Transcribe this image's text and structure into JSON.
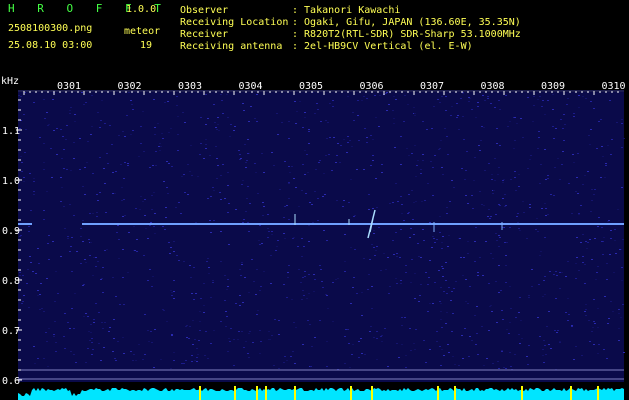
{
  "header": {
    "app_name": "H R O F F T",
    "version": "1.0.0",
    "filename": "2508100300.png",
    "datetime": "25.08.10 03:00",
    "meteor_label": "meteor",
    "meteor_count": "19"
  },
  "info": {
    "observer_label": "Observer",
    "observer_value": ": Takanori Kawachi",
    "location_label": "Receiving Location",
    "location_value": ": Ogaki, Gifu, JAPAN (136.60E, 35.35N)",
    "receiver_label": "Receiver",
    "receiver_value": ": R820T2(RTL-SDR) SDR-Sharp 53.1000MHz",
    "antenna_label": "Receiving antenna",
    "antenna_value": ": 2el-HB9CV Vertical (el. E-W)"
  },
  "axis": {
    "unit": "kHz",
    "y_ticks": [
      "1.1",
      "1.0",
      "0.9",
      "0.8",
      "0.7",
      "0.6"
    ],
    "x_ticks": [
      "0301",
      "0302",
      "0303",
      "0304",
      "0305",
      "0306",
      "0307",
      "0308",
      "0309",
      "0310"
    ]
  },
  "colors": {
    "background": "#000000",
    "waterfall_base": "#0a0a4a",
    "carrier": "#6fa0ff",
    "meteor_echo": "#aaddff",
    "label_green": "#44ff44",
    "label_yellow": "#ffff55",
    "label_cyan": "#55ffff",
    "power_cyan": "#00ffff",
    "power_yellow": "#ffff00"
  }
}
